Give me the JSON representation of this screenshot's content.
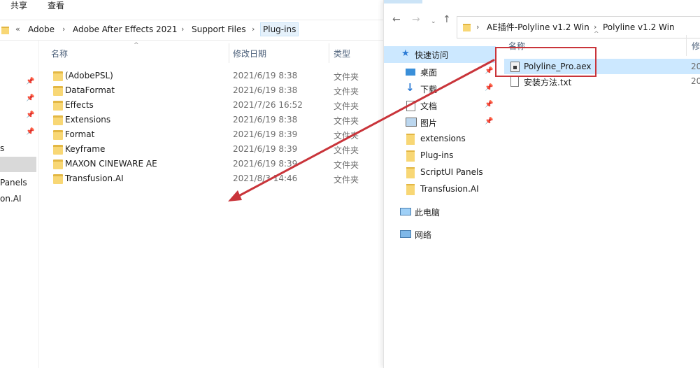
{
  "left_window": {
    "ribbon": {
      "share": "共享",
      "view": "查看"
    },
    "address": {
      "back_marker": "«",
      "crumbs": [
        "Adobe",
        "Adobe After Effects 2021",
        "Support Files",
        "Plug-ins"
      ]
    },
    "nav_partial": [
      "s",
      "Panels",
      "on.AI"
    ],
    "columns": {
      "name": "名称",
      "date": "修改日期",
      "type": "类型"
    },
    "rows": [
      {
        "name": "(AdobePSL)",
        "date": "2021/6/19 8:38",
        "type": "文件夹"
      },
      {
        "name": "DataFormat",
        "date": "2021/6/19 8:38",
        "type": "文件夹"
      },
      {
        "name": "Effects",
        "date": "2021/7/26 16:52",
        "type": "文件夹"
      },
      {
        "name": "Extensions",
        "date": "2021/6/19 8:38",
        "type": "文件夹"
      },
      {
        "name": "Format",
        "date": "2021/6/19 8:39",
        "type": "文件夹"
      },
      {
        "name": "Keyframe",
        "date": "2021/6/19 8:39",
        "type": "文件夹"
      },
      {
        "name": "MAXON CINEWARE AE",
        "date": "2021/6/19 8:39",
        "type": "文件夹"
      },
      {
        "name": "Transfusion.AI",
        "date": "2021/8/3 14:46",
        "type": "文件夹"
      }
    ]
  },
  "right_window": {
    "address": {
      "crumbs": [
        "AE插件-Polyline v1.2 Win",
        "Polyline v1.2 Win"
      ]
    },
    "nav": {
      "quick_access": "快速访问",
      "desktop": "桌面",
      "downloads": "下载",
      "documents": "文档",
      "pictures": "图片",
      "folders": [
        "extensions",
        "Plug-ins",
        "ScriptUI Panels",
        "Transfusion.AI"
      ],
      "this_pc": "此电脑",
      "network": "网络"
    },
    "columns": {
      "name": "名称",
      "date_partial": "修"
    },
    "files": [
      {
        "name": "Polyline_Pro.aex",
        "date_partial": "20"
      },
      {
        "name": "安装方法.txt",
        "date_partial": "20"
      }
    ]
  },
  "colors": {
    "selection": "#cce8ff",
    "annotation_red": "#c9343a",
    "folder_yellow": "#f8d775"
  }
}
